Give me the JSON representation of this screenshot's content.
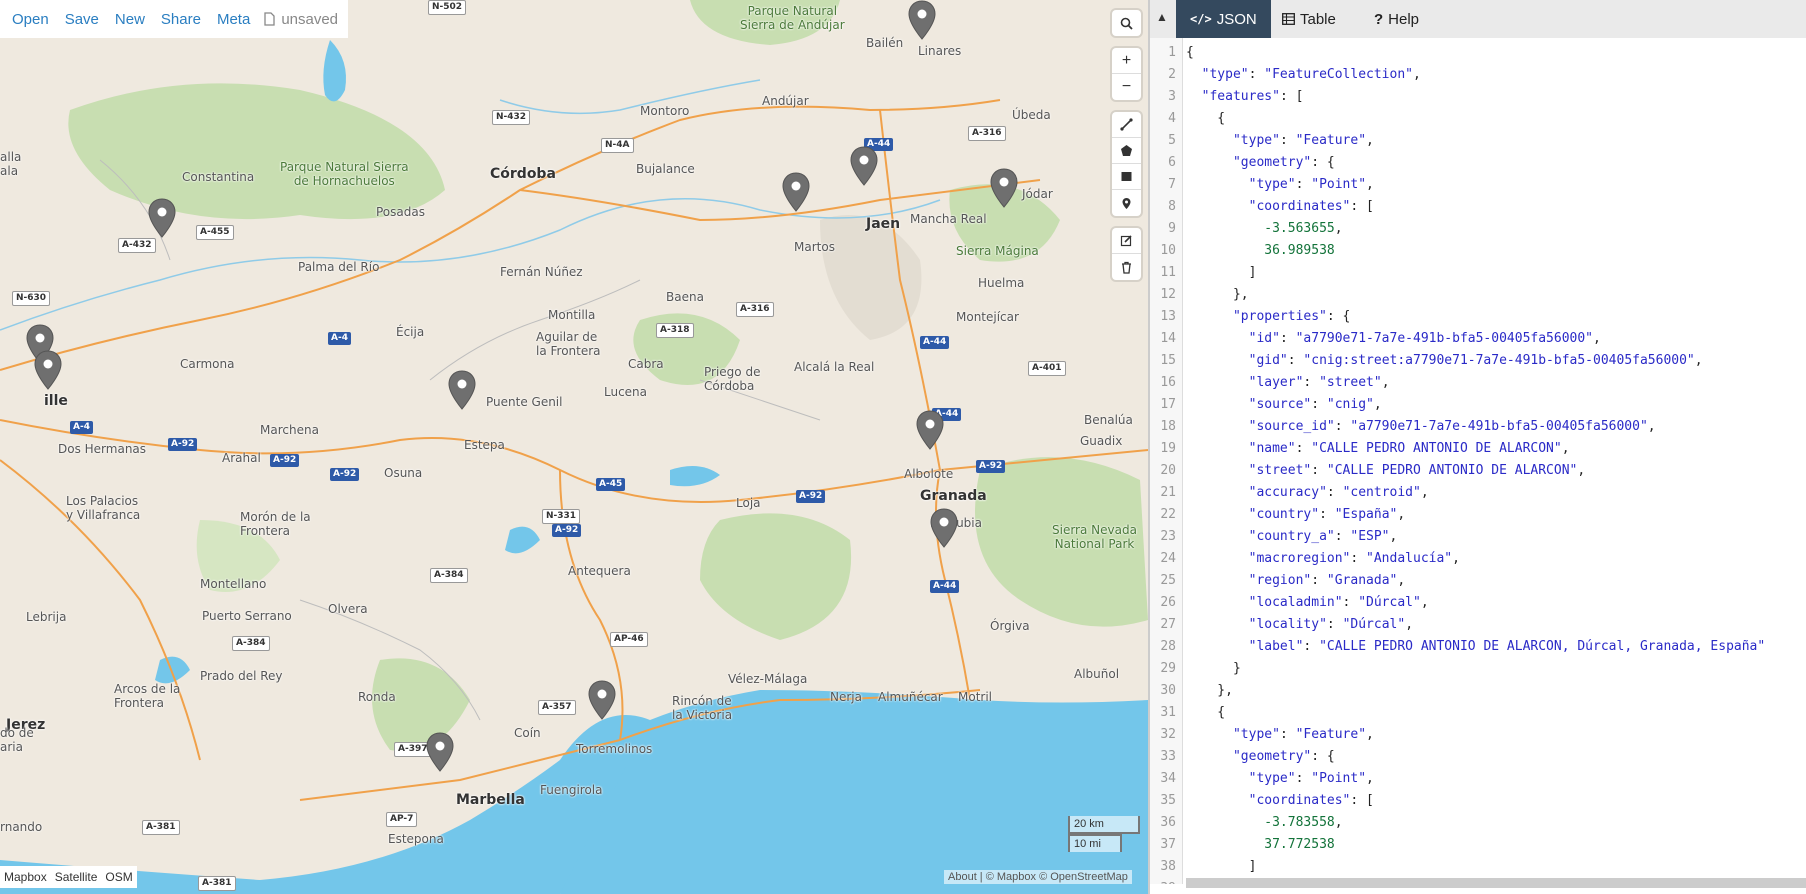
{
  "menu": {
    "items": [
      "Open",
      "Save",
      "New",
      "Share",
      "Meta"
    ],
    "status": "unsaved"
  },
  "map": {
    "places": [
      {
        "t": "N-502",
        "kind": "shield-white"
      },
      {
        "t": "Parque Natural\nSierra de Andújar",
        "kind": "park"
      },
      {
        "t": "Linares",
        "kind": "town"
      },
      {
        "t": "Bailén",
        "kind": "town"
      },
      {
        "t": "N-432",
        "kind": "shield-white"
      },
      {
        "t": "Montoro",
        "kind": "town"
      },
      {
        "t": "Andújar",
        "kind": "town"
      },
      {
        "t": "Úbeda",
        "kind": "town"
      },
      {
        "t": "A-316",
        "kind": "shield-white"
      },
      {
        "t": "N-4A",
        "kind": "shield-white"
      },
      {
        "t": "A-44",
        "kind": "shield-blue"
      },
      {
        "t": "Parque Natural Sierra\nde Hornachuelos",
        "kind": "park"
      },
      {
        "t": "Córdoba",
        "kind": "city"
      },
      {
        "t": "Bujalance",
        "kind": "town"
      },
      {
        "t": "Constantina",
        "kind": "town"
      },
      {
        "t": "Posadas",
        "kind": "town"
      },
      {
        "t": "Jódar",
        "kind": "town"
      },
      {
        "t": "Mancha Real",
        "kind": "town"
      },
      {
        "t": "Jaen",
        "kind": "city"
      },
      {
        "t": "Martos",
        "kind": "town"
      },
      {
        "t": "Sierra Mágina",
        "kind": "park"
      },
      {
        "t": "A-432",
        "kind": "shield-white"
      },
      {
        "t": "A-455",
        "kind": "shield-white"
      },
      {
        "t": "Palma del Río",
        "kind": "town"
      },
      {
        "t": "Fernán Núñez",
        "kind": "town"
      },
      {
        "t": "Huelma",
        "kind": "town"
      },
      {
        "t": "N-630",
        "kind": "shield-white"
      },
      {
        "t": "Baena",
        "kind": "town"
      },
      {
        "t": "A-316",
        "kind": "shield-white"
      },
      {
        "t": "Montilla",
        "kind": "town"
      },
      {
        "t": "Montejícar",
        "kind": "town"
      },
      {
        "t": "A-4",
        "kind": "shield-blue"
      },
      {
        "t": "Écija",
        "kind": "town"
      },
      {
        "t": "A-318",
        "kind": "shield-white"
      },
      {
        "t": "Aguilar de\nla Frontera",
        "kind": "town"
      },
      {
        "t": "A-44",
        "kind": "shield-blue"
      },
      {
        "t": "Carmona",
        "kind": "town"
      },
      {
        "t": "Cabra",
        "kind": "town"
      },
      {
        "t": "Priego de\nCórdoba",
        "kind": "town"
      },
      {
        "t": "Alcalá la Real",
        "kind": "town"
      },
      {
        "t": "A-401",
        "kind": "shield-white"
      },
      {
        "t": "ille",
        "kind": "city"
      },
      {
        "t": "Puente Genil",
        "kind": "town"
      },
      {
        "t": "Lucena",
        "kind": "town"
      },
      {
        "t": "A-4",
        "kind": "shield-blue"
      },
      {
        "t": "A-44",
        "kind": "shield-blue"
      },
      {
        "t": "Benalúa",
        "kind": "town"
      },
      {
        "t": "Marchena",
        "kind": "town"
      },
      {
        "t": "A-92",
        "kind": "shield-blue"
      },
      {
        "t": "Dos Hermanas",
        "kind": "town"
      },
      {
        "t": "Estepa",
        "kind": "town"
      },
      {
        "t": "Guadix",
        "kind": "town"
      },
      {
        "t": "Arahal",
        "kind": "town"
      },
      {
        "t": "A-92",
        "kind": "shield-blue"
      },
      {
        "t": "A-92",
        "kind": "shield-blue"
      },
      {
        "t": "Osuna",
        "kind": "town"
      },
      {
        "t": "Albolote",
        "kind": "town"
      },
      {
        "t": "A-92",
        "kind": "shield-blue"
      },
      {
        "t": "A-45",
        "kind": "shield-blue"
      },
      {
        "t": "Granada",
        "kind": "city"
      },
      {
        "t": "Los Palacios\ny Villafranca",
        "kind": "town"
      },
      {
        "t": "Loja",
        "kind": "town"
      },
      {
        "t": "A-92",
        "kind": "shield-blue"
      },
      {
        "t": "N-331",
        "kind": "shield-white"
      },
      {
        "t": "Morón de la\nFrontera",
        "kind": "town"
      },
      {
        "t": "A-92",
        "kind": "shield-blue"
      },
      {
        "t": "La Zubia",
        "kind": "town"
      },
      {
        "t": "Sierra Nevada\nNational Park",
        "kind": "park"
      },
      {
        "t": "Antequera",
        "kind": "town"
      },
      {
        "t": "A-384",
        "kind": "shield-white"
      },
      {
        "t": "Montellano",
        "kind": "town"
      },
      {
        "t": "A-44",
        "kind": "shield-blue"
      },
      {
        "t": "Olvera",
        "kind": "town"
      },
      {
        "t": "Puerto Serrano",
        "kind": "town"
      },
      {
        "t": "Lebrija",
        "kind": "town"
      },
      {
        "t": "Órgiva",
        "kind": "town"
      },
      {
        "t": "AP-46",
        "kind": "shield-white"
      },
      {
        "t": "A-384",
        "kind": "shield-white"
      },
      {
        "t": "Prado del Rey",
        "kind": "town"
      },
      {
        "t": "Vélez-Málaga",
        "kind": "town"
      },
      {
        "t": "Albuñol",
        "kind": "town"
      },
      {
        "t": "Arcos de la\nFrontera",
        "kind": "town"
      },
      {
        "t": "Ronda",
        "kind": "town"
      },
      {
        "t": "Nerja",
        "kind": "town"
      },
      {
        "t": "Almuñécar",
        "kind": "town"
      },
      {
        "t": "Motril",
        "kind": "town"
      },
      {
        "t": "Rincón de\nla Victoria",
        "kind": "town"
      },
      {
        "t": "Jerez",
        "kind": "city"
      },
      {
        "t": "A-357",
        "kind": "shield-white"
      },
      {
        "t": "Coín",
        "kind": "town"
      },
      {
        "t": "do de\naria",
        "kind": "town"
      },
      {
        "t": "A-397",
        "kind": "shield-white"
      },
      {
        "t": "Torremolinos",
        "kind": "town"
      },
      {
        "t": "Fuengirola",
        "kind": "town"
      },
      {
        "t": "Marbella",
        "kind": "city"
      },
      {
        "t": "AP-7",
        "kind": "shield-white"
      },
      {
        "t": "rnando",
        "kind": "town"
      },
      {
        "t": "A-381",
        "kind": "shield-white"
      },
      {
        "t": "Estepona",
        "kind": "town"
      },
      {
        "t": "A-381",
        "kind": "shield-white"
      },
      {
        "t": "alla\nala",
        "kind": "town"
      }
    ],
    "layers": [
      "Mapbox",
      "Satellite",
      "OSM"
    ],
    "active_layer": "Mapbox",
    "scale_km": "20 km",
    "scale_mi": "10 mi",
    "attribution": {
      "about": "About",
      "sep": " | ",
      "mapbox": "© Mapbox",
      "osm": "© OpenStreetMap"
    }
  },
  "panel": {
    "tabs": [
      {
        "label": "JSON",
        "icon": "code-icon"
      },
      {
        "label": "Table",
        "icon": "table-icon"
      },
      {
        "label": "Help",
        "icon": "question-icon"
      }
    ],
    "active_tab": "JSON"
  },
  "code_lines": [
    [
      [
        "k",
        "{"
      ]
    ],
    [
      [
        "k",
        "  "
      ],
      [
        "s",
        "\"type\""
      ],
      [
        "k",
        ": "
      ],
      [
        "s",
        "\"FeatureCollection\""
      ],
      [
        "k",
        ","
      ]
    ],
    [
      [
        "k",
        "  "
      ],
      [
        "s",
        "\"features\""
      ],
      [
        "k",
        ": ["
      ]
    ],
    [
      [
        "k",
        "    {"
      ]
    ],
    [
      [
        "k",
        "      "
      ],
      [
        "s",
        "\"type\""
      ],
      [
        "k",
        ": "
      ],
      [
        "s",
        "\"Feature\""
      ],
      [
        "k",
        ","
      ]
    ],
    [
      [
        "k",
        "      "
      ],
      [
        "s",
        "\"geometry\""
      ],
      [
        "k",
        ": {"
      ]
    ],
    [
      [
        "k",
        "        "
      ],
      [
        "s",
        "\"type\""
      ],
      [
        "k",
        ": "
      ],
      [
        "s",
        "\"Point\""
      ],
      [
        "k",
        ","
      ]
    ],
    [
      [
        "k",
        "        "
      ],
      [
        "s",
        "\"coordinates\""
      ],
      [
        "k",
        ": ["
      ]
    ],
    [
      [
        "k",
        "          "
      ],
      [
        "n",
        "-3.563655"
      ],
      [
        "k",
        ","
      ]
    ],
    [
      [
        "k",
        "          "
      ],
      [
        "n",
        "36.989538"
      ]
    ],
    [
      [
        "k",
        "        ]"
      ]
    ],
    [
      [
        "k",
        "      },"
      ]
    ],
    [
      [
        "k",
        "      "
      ],
      [
        "s",
        "\"properties\""
      ],
      [
        "k",
        ": {"
      ]
    ],
    [
      [
        "k",
        "        "
      ],
      [
        "s",
        "\"id\""
      ],
      [
        "k",
        ": "
      ],
      [
        "s",
        "\"a7790e71-7a7e-491b-bfa5-00405fa56000\""
      ],
      [
        "k",
        ","
      ]
    ],
    [
      [
        "k",
        "        "
      ],
      [
        "s",
        "\"gid\""
      ],
      [
        "k",
        ": "
      ],
      [
        "s",
        "\"cnig:street:a7790e71-7a7e-491b-bfa5-00405fa56000\""
      ],
      [
        "k",
        ","
      ]
    ],
    [
      [
        "k",
        "        "
      ],
      [
        "s",
        "\"layer\""
      ],
      [
        "k",
        ": "
      ],
      [
        "s",
        "\"street\""
      ],
      [
        "k",
        ","
      ]
    ],
    [
      [
        "k",
        "        "
      ],
      [
        "s",
        "\"source\""
      ],
      [
        "k",
        ": "
      ],
      [
        "s",
        "\"cnig\""
      ],
      [
        "k",
        ","
      ]
    ],
    [
      [
        "k",
        "        "
      ],
      [
        "s",
        "\"source_id\""
      ],
      [
        "k",
        ": "
      ],
      [
        "s",
        "\"a7790e71-7a7e-491b-bfa5-00405fa56000\""
      ],
      [
        "k",
        ","
      ]
    ],
    [
      [
        "k",
        "        "
      ],
      [
        "s",
        "\"name\""
      ],
      [
        "k",
        ": "
      ],
      [
        "s",
        "\"CALLE PEDRO ANTONIO DE ALARCON\""
      ],
      [
        "k",
        ","
      ]
    ],
    [
      [
        "k",
        "        "
      ],
      [
        "s",
        "\"street\""
      ],
      [
        "k",
        ": "
      ],
      [
        "s",
        "\"CALLE PEDRO ANTONIO DE ALARCON\""
      ],
      [
        "k",
        ","
      ]
    ],
    [
      [
        "k",
        "        "
      ],
      [
        "s",
        "\"accuracy\""
      ],
      [
        "k",
        ": "
      ],
      [
        "s",
        "\"centroid\""
      ],
      [
        "k",
        ","
      ]
    ],
    [
      [
        "k",
        "        "
      ],
      [
        "s",
        "\"country\""
      ],
      [
        "k",
        ": "
      ],
      [
        "s",
        "\"España\""
      ],
      [
        "k",
        ","
      ]
    ],
    [
      [
        "k",
        "        "
      ],
      [
        "s",
        "\"country_a\""
      ],
      [
        "k",
        ": "
      ],
      [
        "s",
        "\"ESP\""
      ],
      [
        "k",
        ","
      ]
    ],
    [
      [
        "k",
        "        "
      ],
      [
        "s",
        "\"macroregion\""
      ],
      [
        "k",
        ": "
      ],
      [
        "s",
        "\"Andalucía\""
      ],
      [
        "k",
        ","
      ]
    ],
    [
      [
        "k",
        "        "
      ],
      [
        "s",
        "\"region\""
      ],
      [
        "k",
        ": "
      ],
      [
        "s",
        "\"Granada\""
      ],
      [
        "k",
        ","
      ]
    ],
    [
      [
        "k",
        "        "
      ],
      [
        "s",
        "\"localadmin\""
      ],
      [
        "k",
        ": "
      ],
      [
        "s",
        "\"Dúrcal\""
      ],
      [
        "k",
        ","
      ]
    ],
    [
      [
        "k",
        "        "
      ],
      [
        "s",
        "\"locality\""
      ],
      [
        "k",
        ": "
      ],
      [
        "s",
        "\"Dúrcal\""
      ],
      [
        "k",
        ","
      ]
    ],
    [
      [
        "k",
        "        "
      ],
      [
        "s",
        "\"label\""
      ],
      [
        "k",
        ": "
      ],
      [
        "s",
        "\"CALLE PEDRO ANTONIO DE ALARCON, Dúrcal, Granada, España\""
      ]
    ],
    [
      [
        "k",
        "      }"
      ]
    ],
    [
      [
        "k",
        "    },"
      ]
    ],
    [
      [
        "k",
        "    {"
      ]
    ],
    [
      [
        "k",
        "      "
      ],
      [
        "s",
        "\"type\""
      ],
      [
        "k",
        ": "
      ],
      [
        "s",
        "\"Feature\""
      ],
      [
        "k",
        ","
      ]
    ],
    [
      [
        "k",
        "      "
      ],
      [
        "s",
        "\"geometry\""
      ],
      [
        "k",
        ": {"
      ]
    ],
    [
      [
        "k",
        "        "
      ],
      [
        "s",
        "\"type\""
      ],
      [
        "k",
        ": "
      ],
      [
        "s",
        "\"Point\""
      ],
      [
        "k",
        ","
      ]
    ],
    [
      [
        "k",
        "        "
      ],
      [
        "s",
        "\"coordinates\""
      ],
      [
        "k",
        ": ["
      ]
    ],
    [
      [
        "k",
        "          "
      ],
      [
        "n",
        "-3.783558"
      ],
      [
        "k",
        ","
      ]
    ],
    [
      [
        "k",
        "          "
      ],
      [
        "n",
        "37.772538"
      ]
    ],
    [
      [
        "k",
        "        ]"
      ]
    ],
    [
      [
        "k",
        "      },"
      ]
    ]
  ],
  "colors": {
    "accent": "#2a7ec1",
    "tab_active": "#34495e",
    "water": "#73c6ea",
    "park": "#c8deb1",
    "road": "#f0a14a",
    "pin": "#6f6f6f"
  }
}
